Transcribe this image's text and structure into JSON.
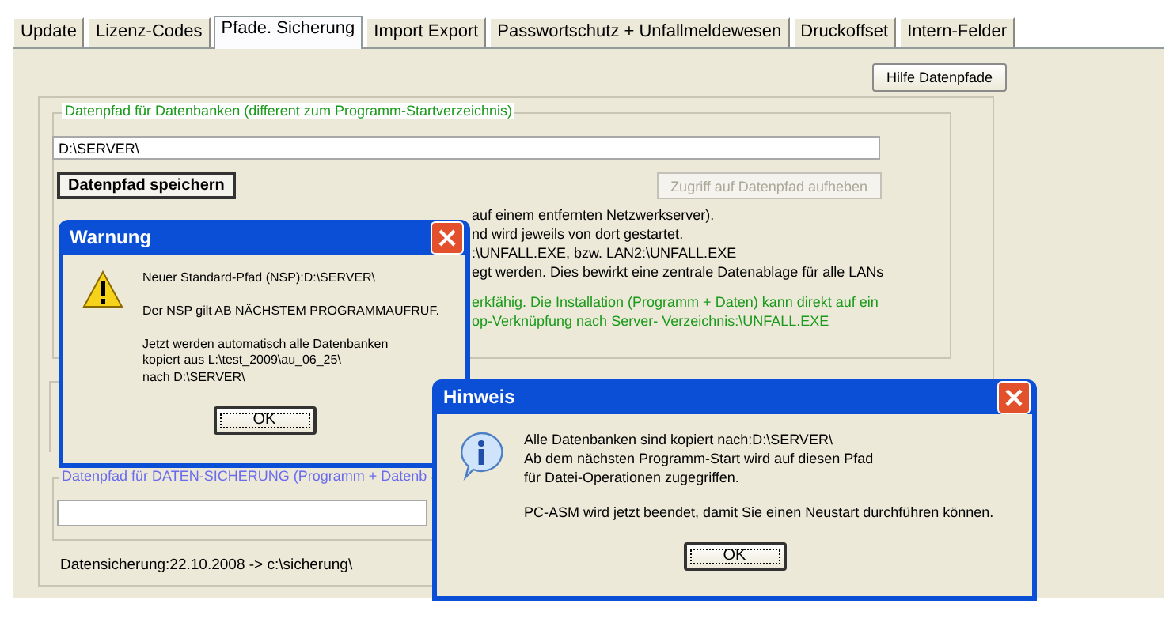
{
  "tabs": [
    {
      "label": "Update",
      "selected": false
    },
    {
      "label": "Lizenz-Codes",
      "selected": false
    },
    {
      "label": "Pfade. Sicherung",
      "selected": true
    },
    {
      "label": "Import Export",
      "selected": false
    },
    {
      "label": "Passwortschutz + Unfallmeldewesen",
      "selected": false
    },
    {
      "label": "Druckoffset",
      "selected": false
    },
    {
      "label": "Intern-Felder",
      "selected": false
    }
  ],
  "help_button": "Hilfe Datenpfade",
  "db_path_group": {
    "legend": "Datenpfad für Datenbanken (different zum Programm-Startverzeichnis)",
    "path_value": "D:\\SERVER\\",
    "save_button": "Datenpfad speichern",
    "release_button": {
      "label": "Zugriff auf Datenpfad aufheben",
      "disabled": true
    },
    "info_lines": [
      "auf einem entfernten Netzwerkserver).",
      "nd wird jeweils von dort gestartet.",
      ":\\UNFALL.EXE, bzw. LAN2:\\UNFALL.EXE",
      "egt werden. Dies bewirkt eine zentrale Datenablage für alle LANs"
    ],
    "note_lines": [
      "erkfähig. Die Installation (Programm + Daten) kann direkt auf ein",
      "op-Verknüpfung nach Server- Verzeichnis:\\UNFALL.EXE"
    ]
  },
  "backup_group": {
    "legend": "Datenpfad für DATEN-SICHERUNG  (Programm + Datenb",
    "status": "Datensicherung:22.10.2008 -> c:\\sicherung\\"
  },
  "dialogs": [
    {
      "kind": "warning",
      "title": "Warnung",
      "paragraphs": [
        "Neuer Standard-Pfad (NSP):D:\\SERVER\\",
        "Der NSP gilt AB NÄCHSTEM PROGRAMMAUFRUF.",
        "Jetzt werden automatisch alle Datenbanken\nkopiert aus L:\\test_2009\\au_06_25\\\nnach D:\\SERVER\\"
      ],
      "ok": "OK"
    },
    {
      "kind": "info",
      "title": "Hinweis",
      "paragraphs": [
        "Alle Datenbanken sind kopiert nach:D:\\SERVER\\\nAb dem nächsten Programm-Start wird auf diesen Pfad\nfür Datei-Operationen zugegriffen.",
        "PC-ASM wird jetzt beendet, damit Sie einen Neustart durchführen können."
      ],
      "ok": "OK"
    }
  ]
}
